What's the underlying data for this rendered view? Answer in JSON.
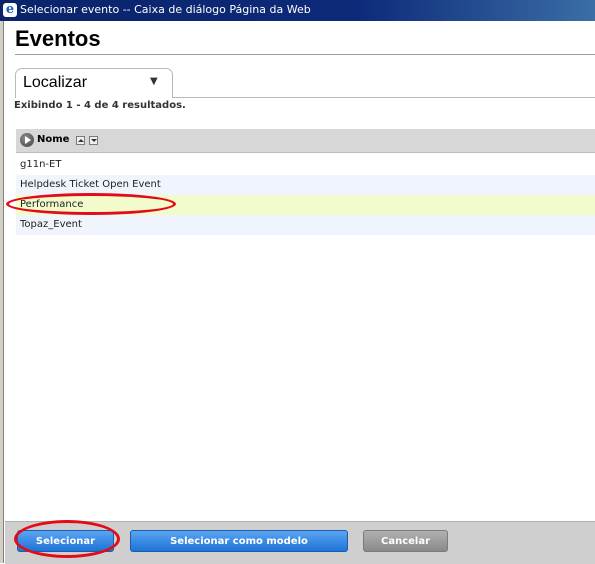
{
  "window": {
    "title": "Selecionar evento -- Caixa de diálogo Página da Web",
    "icon": "ie-icon"
  },
  "page": {
    "title": "Eventos"
  },
  "tab": {
    "label": "Localizar",
    "icon": "caret-down-icon"
  },
  "results_text": "Exibindo 1 - 4 de 4 resultados.",
  "table": {
    "column": "Nome",
    "rows": [
      "g11n-ET",
      "Helpdesk Ticket Open Event",
      "Performance",
      "Topaz_Event"
    ],
    "selected_row": 2,
    "selected_color": "#f1fbcb"
  },
  "buttons": {
    "select": "Selecionar",
    "select_template": "Selecionar como modelo",
    "cancel": "Cancelar"
  },
  "colors": {
    "accent_blue": "#1f73d6",
    "annotation_red": "#e30b17"
  }
}
